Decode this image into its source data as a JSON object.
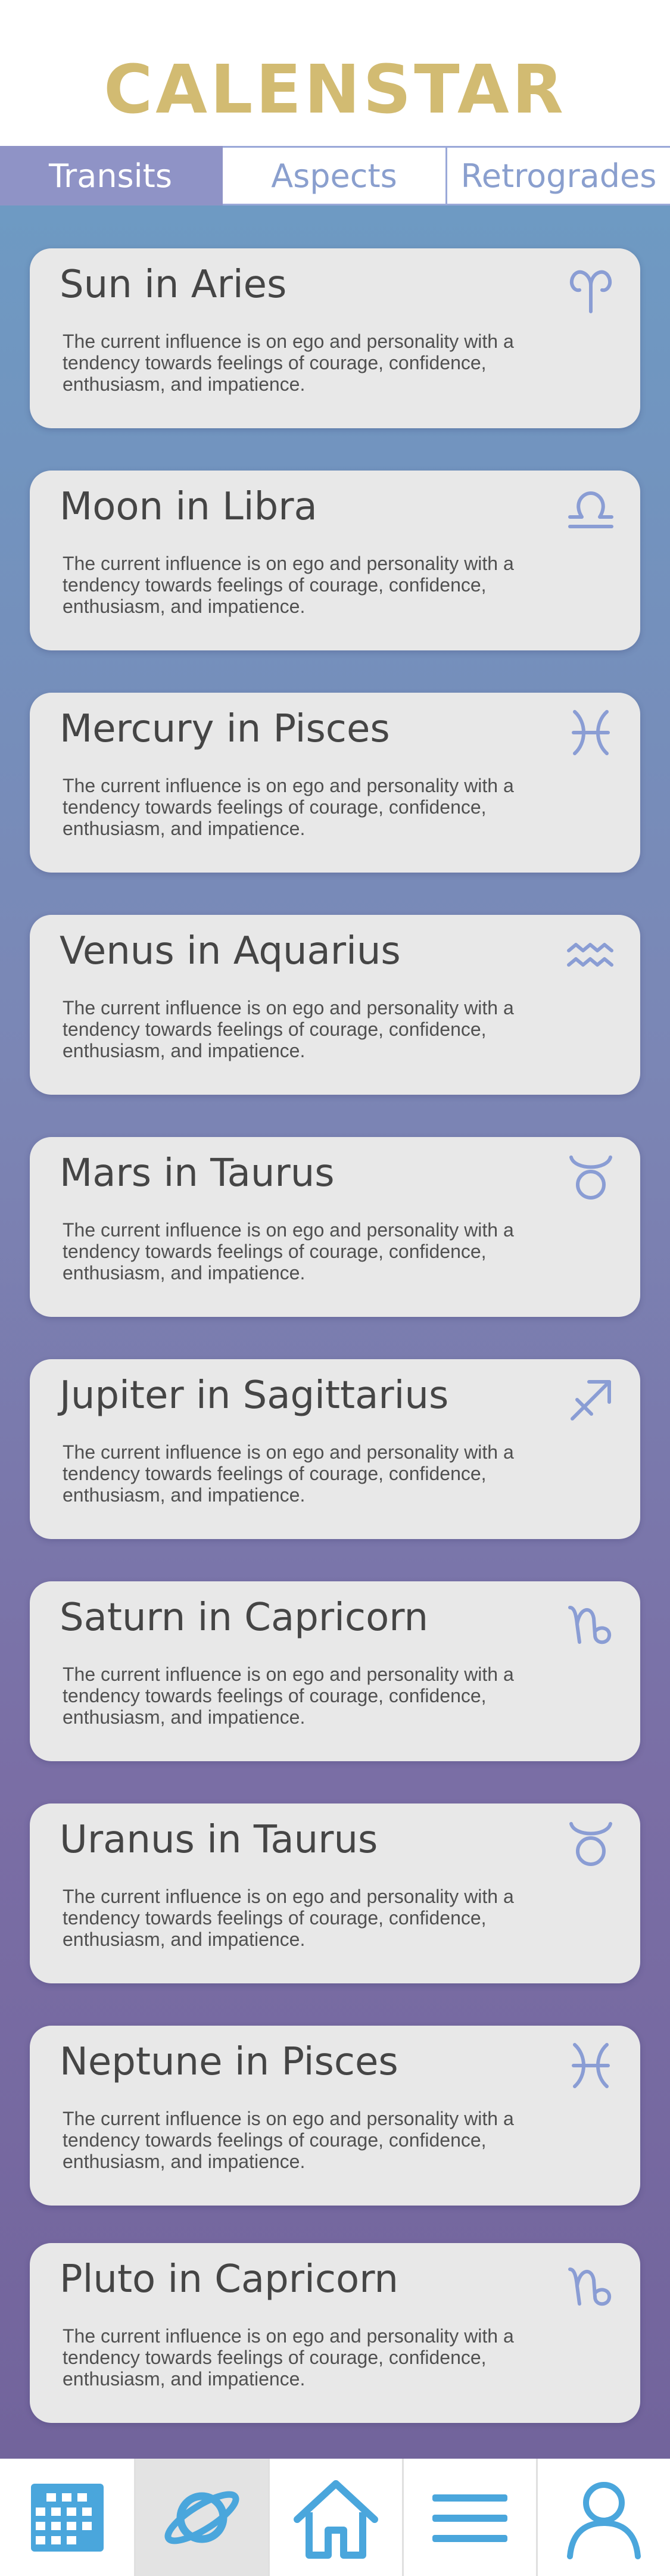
{
  "app": {
    "logo_text": "CALENSTAR"
  },
  "tabs": [
    {
      "label": "Transits",
      "active": true
    },
    {
      "label": "Aspects",
      "active": false
    },
    {
      "label": "Retrogrades",
      "active": false
    }
  ],
  "transits": [
    {
      "title": "Sun in Aries",
      "sign_icon": "aries-icon",
      "body": "The current influence is on ego and personality with a tendency towards feelings of courage, confidence, enthusiasm, and impatience."
    },
    {
      "title": "Moon in Libra",
      "sign_icon": "libra-icon",
      "body": "The current influence is on ego and personality with a tendency towards feelings of courage, confidence, enthusiasm, and impatience."
    },
    {
      "title": "Mercury in Pisces",
      "sign_icon": "pisces-icon",
      "body": "The current influence is on ego and personality with a tendency towards feelings of courage, confidence, enthusiasm, and impatience."
    },
    {
      "title": "Venus in Aquarius",
      "sign_icon": "aquarius-icon",
      "body": "The current influence is on ego and personality with a tendency towards feelings of courage, confidence, enthusiasm, and impatience."
    },
    {
      "title": "Mars in Taurus",
      "sign_icon": "taurus-icon",
      "body": "The current influence is on ego and personality with a tendency towards feelings of courage, confidence, enthusiasm, and impatience."
    },
    {
      "title": "Jupiter in Sagittarius",
      "sign_icon": "sagittarius-icon",
      "body": "The current influence is on ego and personality with a tendency towards feelings of courage, confidence, enthusiasm, and impatience."
    },
    {
      "title": "Saturn in Capricorn",
      "sign_icon": "capricorn-icon",
      "body": "The current influence is on ego and personality with a tendency towards feelings of courage, confidence, enthusiasm, and impatience."
    },
    {
      "title": "Uranus in Taurus",
      "sign_icon": "taurus-icon",
      "body": "The current influence is on ego and personality with a tendency towards feelings of courage, confidence, enthusiasm, and impatience."
    },
    {
      "title": "Neptune in Pisces",
      "sign_icon": "pisces-icon",
      "body": "The current influence is on ego and personality with a tendency towards feelings of courage, confidence, enthusiasm, and impatience."
    },
    {
      "title": "Pluto in Capricorn",
      "sign_icon": "capricorn-icon",
      "body": "The current influence is on ego and personality with a tendency towards feelings of courage, confidence, enthusiasm, and impatience."
    }
  ],
  "bottom_nav": [
    {
      "icon": "calendar-icon",
      "active": false
    },
    {
      "icon": "planet-icon",
      "active": true
    },
    {
      "icon": "home-icon",
      "active": false
    },
    {
      "icon": "menu-icon",
      "active": false
    },
    {
      "icon": "user-icon",
      "active": false
    }
  ],
  "colors": {
    "logo": "#d2bb72",
    "tab_active_bg": "#8f93c6",
    "tab_text": "#8a9fce",
    "zodiac_icon": "#8a9dd4",
    "nav_icon": "#4aa6dc",
    "card_bg": "#e8e8e8"
  }
}
